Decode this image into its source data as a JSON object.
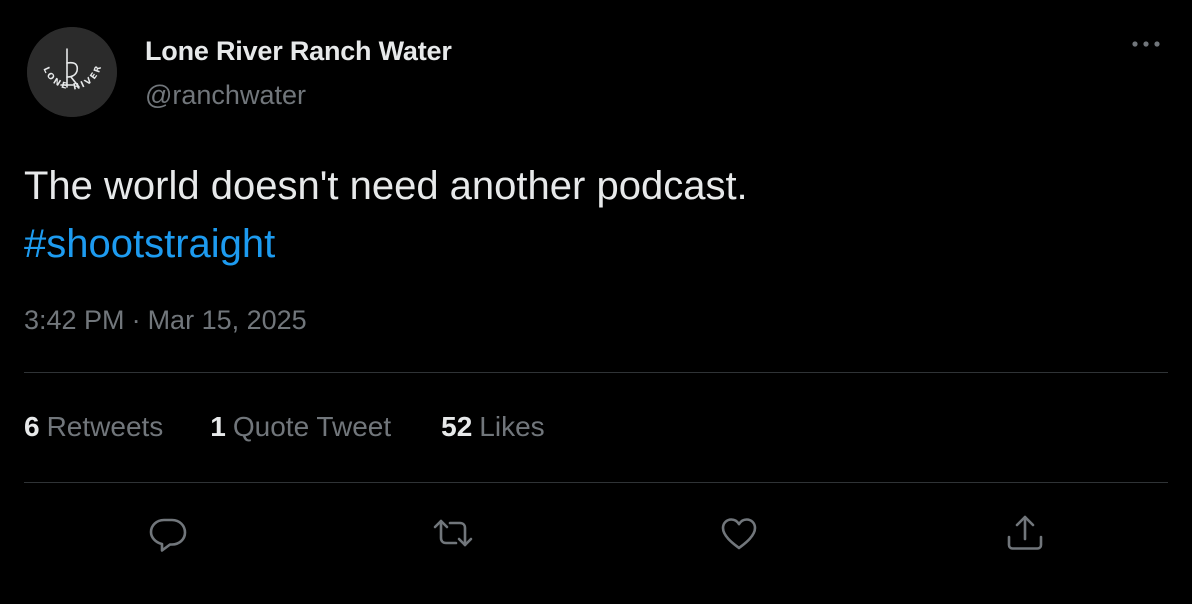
{
  "author": {
    "display_name": "Lone River Ranch Water",
    "handle": "@ranchwater",
    "avatar_text": "LONE RIVER"
  },
  "tweet": {
    "text": "The world doesn't need another podcast.",
    "hashtag": "#shootstraight",
    "time": "3:42 PM",
    "separator": "·",
    "date": "Mar 15, 2025"
  },
  "stats": {
    "retweets_count": "6",
    "retweets_label": "Retweets",
    "quotes_count": "1",
    "quotes_label": "Quote Tweet",
    "likes_count": "52",
    "likes_label": "Likes"
  },
  "actions": [
    "reply-icon",
    "retweet-icon",
    "like-icon",
    "share-icon"
  ],
  "colors": {
    "background": "#000000",
    "primary_text": "#e7e9ea",
    "secondary_text": "#71767b",
    "link": "#1d9bf0",
    "divider": "#2f3336"
  }
}
